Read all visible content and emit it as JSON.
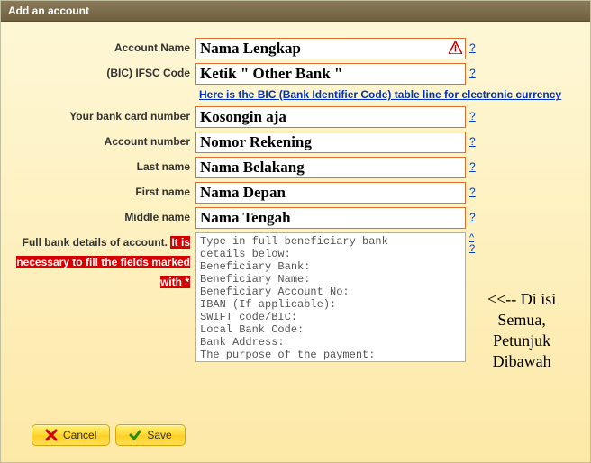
{
  "title": "Add an account",
  "labels": {
    "account_name": "Account Name",
    "ifsc": "(BIC) IFSC Code",
    "card": "Your bank card number",
    "acct_no": "Account number",
    "last": "Last name",
    "first": "First name",
    "middle": "Middle name",
    "details_plain": "Full bank details of account.",
    "details_warn": "It is necessary to fill the fields marked with *"
  },
  "values": {
    "account_name": "Nama Lengkap",
    "ifsc": "Ketik \" Other Bank \"",
    "card": "Kosongin aja",
    "acct_no": "Nomor Rekening",
    "last": "Nama Belakang",
    "first": "Nama Depan",
    "middle": "Nama Tengah",
    "details": "Type in full beneficiary bank\ndetails below:\nBeneficiary Bank:\nBeneficiary Name:\nBeneficiary Account No:\nIBAN (If applicable):\nSWIFT code/BIC:\nLocal Bank Code:\nBank Address:\nThe purpose of the payment:"
  },
  "bic_link": "Here is the BIC (Bank Identifier Code) table line for electronic currency",
  "help": "?",
  "caret": "^",
  "side_note": "<<-- Di isi\nSemua,\nPetunjuk\nDibawah",
  "buttons": {
    "cancel": "Cancel",
    "save": "Save"
  }
}
